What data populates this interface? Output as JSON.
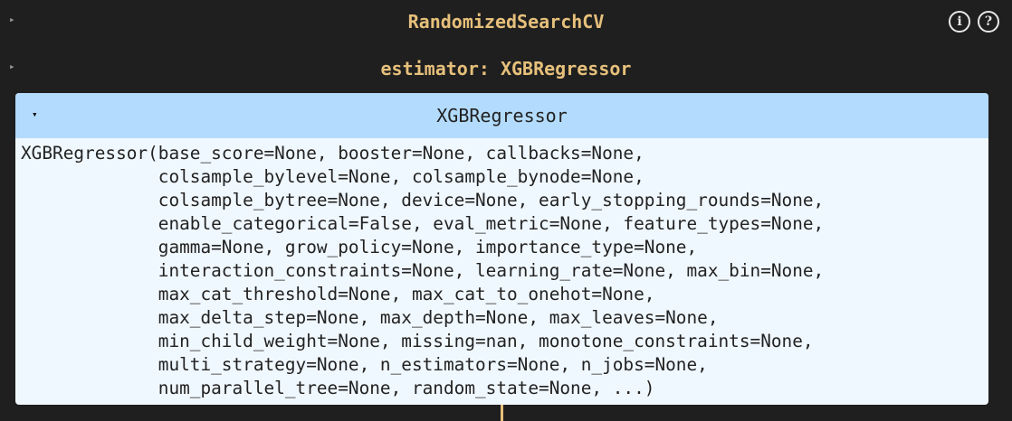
{
  "outer": {
    "toggle_icon": "▸",
    "title": "RandomizedSearchCV",
    "info_icon_glyph": "i",
    "help_icon_glyph": "?"
  },
  "estimator_row": {
    "toggle_icon": "▸",
    "title": "estimator: XGBRegressor"
  },
  "inner": {
    "toggle_icon": "▾",
    "title": "XGBRegressor",
    "repr_lines": [
      "XGBRegressor(base_score=None, booster=None, callbacks=None,",
      "             colsample_bylevel=None, colsample_bynode=None,",
      "             colsample_bytree=None, device=None, early_stopping_rounds=None,",
      "             enable_categorical=False, eval_metric=None, feature_types=None,",
      "             gamma=None, grow_policy=None, importance_type=None,",
      "             interaction_constraints=None, learning_rate=None, max_bin=None,",
      "             max_cat_threshold=None, max_cat_to_onehot=None,",
      "             max_delta_step=None, max_depth=None, max_leaves=None,",
      "             min_child_weight=None, missing=nan, monotone_constraints=None,",
      "             multi_strategy=None, n_estimators=None, n_jobs=None,",
      "             num_parallel_tree=None, random_state=None, ...)"
    ]
  },
  "colors": {
    "background": "#1f1f1f",
    "title_gold": "#e6c07b",
    "card_header": "#b3dbfd",
    "card_body": "#f0f8ff"
  }
}
